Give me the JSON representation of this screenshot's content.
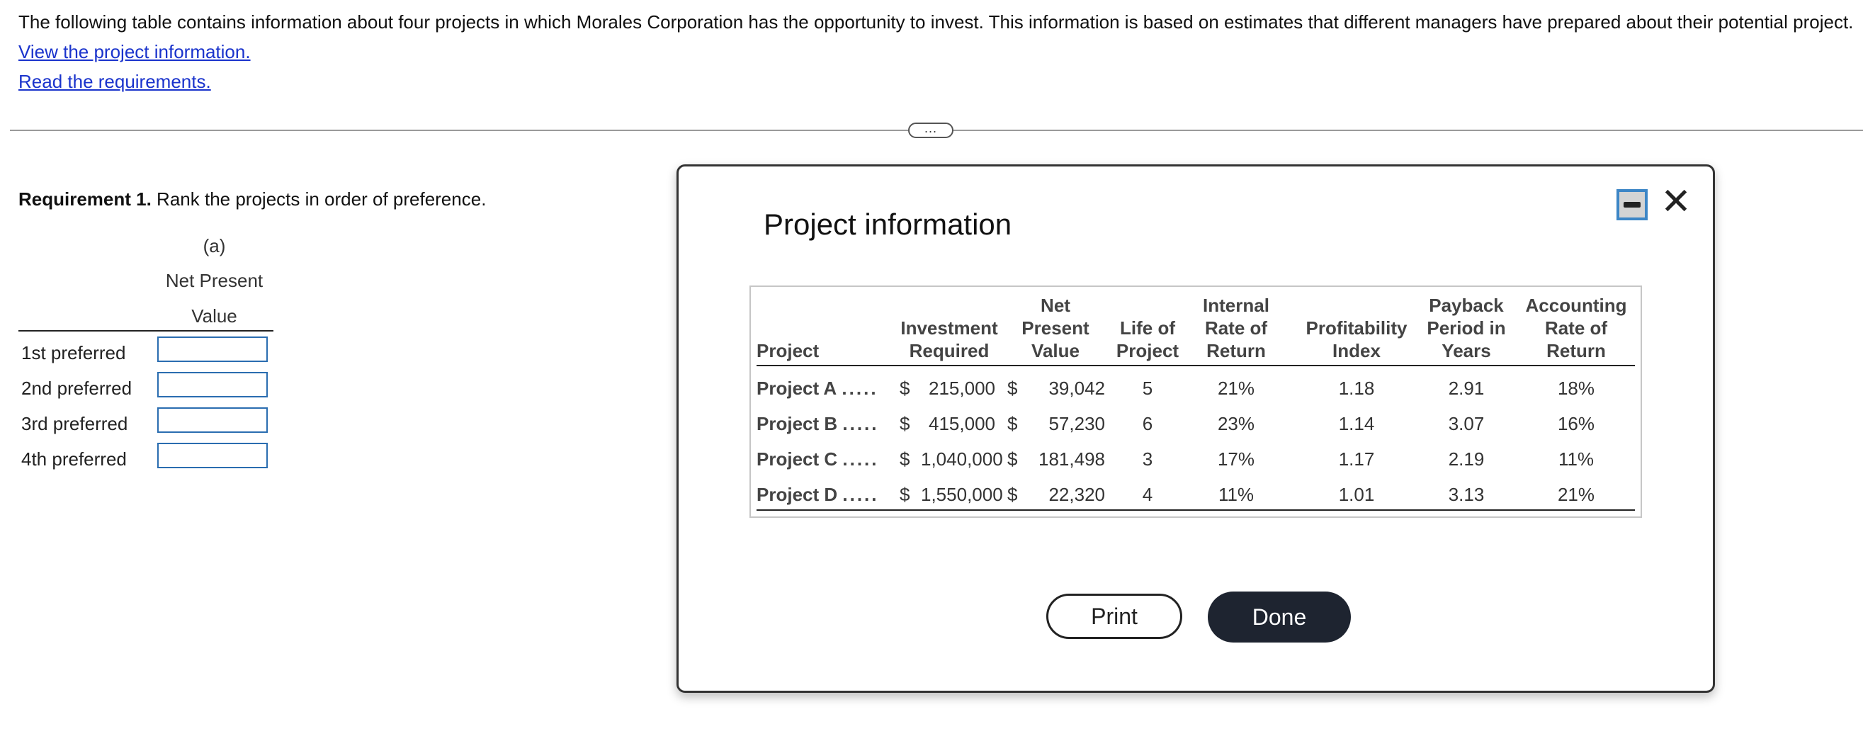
{
  "intro": {
    "text": "The following table contains information about four projects in which Morales Corporation has the opportunity to invest. This information is based on estimates that different managers have prepared about their potential project.",
    "link_project_info": "View the project information.",
    "link_requirements": "Read the requirements."
  },
  "divider_toggle": "...",
  "requirement": {
    "label": "Requirement 1.",
    "text": " Rank the projects in order of preference."
  },
  "ranking": {
    "col_letter": "(a)",
    "col_header_line1": "Net Present",
    "col_header_line2": "Value",
    "rows": [
      {
        "label": "1st preferred",
        "value": ""
      },
      {
        "label": "2nd preferred",
        "value": ""
      },
      {
        "label": "3rd preferred",
        "value": ""
      },
      {
        "label": "4th preferred",
        "value": ""
      }
    ]
  },
  "modal": {
    "title": "Project information",
    "minimize_icon": "minimize-icon",
    "close_icon": "close-icon",
    "close_glyph": "✕",
    "headers": {
      "project": "Project",
      "investment_l1": "Investment",
      "investment_l2": "Required",
      "npv_l1": "Net",
      "npv_l2": "Present",
      "npv_l3": "Value",
      "life_l1": "Life of",
      "life_l2": "Project",
      "irr_l1": "Internal",
      "irr_l2": "Rate of",
      "irr_l3": "Return",
      "pi_l1": "Profitability",
      "pi_l2": "Index",
      "payback_l1": "Payback",
      "payback_l2": "Period in",
      "payback_l3": "Years",
      "arr_l1": "Accounting",
      "arr_l2": "Rate of",
      "arr_l3": "Return"
    },
    "rows": [
      {
        "name": "Project A",
        "dots": ".....",
        "cur1": "$",
        "investment": "215,000",
        "cur2": "$",
        "npv": "39,042",
        "life": "5",
        "irr": "21%",
        "pi": "1.18",
        "payback": "2.91",
        "arr": "18%"
      },
      {
        "name": "Project B",
        "dots": ".....",
        "cur1": "$",
        "investment": "415,000",
        "cur2": "$",
        "npv": "57,230",
        "life": "6",
        "irr": "23%",
        "pi": "1.14",
        "payback": "3.07",
        "arr": "16%"
      },
      {
        "name": "Project C",
        "dots": ".....",
        "cur1": "$",
        "investment": "1,040,000",
        "cur2": "$",
        "npv": "181,498",
        "life": "3",
        "irr": "17%",
        "pi": "1.17",
        "payback": "2.19",
        "arr": "11%"
      },
      {
        "name": "Project D",
        "dots": ".....",
        "cur1": "$",
        "investment": "1,550,000",
        "cur2": "$",
        "npv": "22,320",
        "life": "4",
        "irr": "11%",
        "pi": "1.01",
        "payback": "3.13",
        "arr": "21%"
      }
    ],
    "print_label": "Print",
    "done_label": "Done"
  },
  "colors": {
    "link": "#1a33cc",
    "input_border": "#2a6db0",
    "done_bg": "#1e2430",
    "minimize_border": "#3d86c6"
  }
}
